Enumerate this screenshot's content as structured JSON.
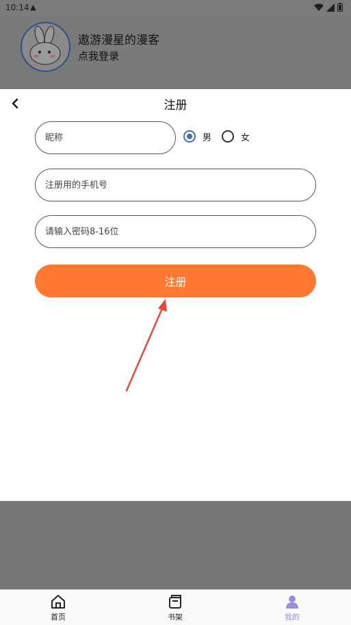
{
  "status": {
    "time": "10:14"
  },
  "header": {
    "app_name": "遨游漫星的漫客",
    "login_link": "点我登录"
  },
  "sheet": {
    "title": "注册",
    "nickname_placeholder": "昵称",
    "gender": {
      "male": "男",
      "female": "女",
      "selected": "男"
    },
    "phone_placeholder": "注册用的手机号",
    "password_placeholder": "请输入密码8-16位",
    "submit_label": "注册"
  },
  "tabbar": {
    "tabs": [
      {
        "label": "首页",
        "icon": "home-icon"
      },
      {
        "label": "书架",
        "icon": "bookshelf-icon"
      },
      {
        "label": "我的",
        "icon": "user-icon",
        "active": true
      }
    ]
  },
  "colors": {
    "accent": "#ff7a30",
    "radio": "#3d6fb0",
    "tab_active": "#9a8ee0",
    "arrow": "#e04a3a"
  }
}
